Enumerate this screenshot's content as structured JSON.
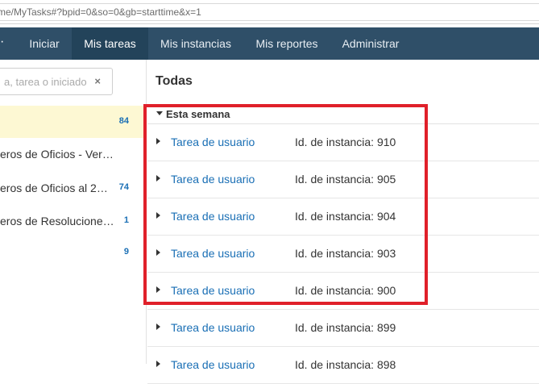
{
  "address_bar": {
    "url": "me/MyTasks#?bpid=0&so=0&gb=starttime&x=1"
  },
  "nav": {
    "items": [
      {
        "label": "Iniciar",
        "active": false
      },
      {
        "label": "Mis tareas",
        "active": true
      },
      {
        "label": "Mis instancias",
        "active": false
      },
      {
        "label": "Mis reportes",
        "active": false
      },
      {
        "label": "Administrar",
        "active": false
      }
    ],
    "colors": {
      "bar": "#2f4f68",
      "active": "#23435a"
    }
  },
  "sidebar": {
    "search": {
      "placeholder": "a, tarea o iniciado",
      "clear_icon": "×"
    },
    "items": [
      {
        "label": "",
        "count": "84",
        "highlighted": true
      },
      {
        "label": "eros de Oficios - Versió…",
        "count": ""
      },
      {
        "label": "eros de Oficios al 2…",
        "count": "74"
      },
      {
        "label": "eros de Resoluciones…",
        "count": "1"
      },
      {
        "label": "",
        "count": "9"
      }
    ]
  },
  "main": {
    "title": "Todas",
    "group": {
      "title": "Esta semana"
    },
    "tasks": [
      {
        "name": "Tarea de usuario",
        "instance": "Id. de instancia: 910"
      },
      {
        "name": "Tarea de usuario",
        "instance": "Id. de instancia: 905"
      },
      {
        "name": "Tarea de usuario",
        "instance": "Id. de instancia: 904"
      },
      {
        "name": "Tarea de usuario",
        "instance": "Id. de instancia: 903"
      },
      {
        "name": "Tarea de usuario",
        "instance": "Id. de instancia: 900"
      },
      {
        "name": "Tarea de usuario",
        "instance": "Id. de instancia: 899"
      },
      {
        "name": "Tarea de usuario",
        "instance": "Id. de instancia: 898"
      }
    ]
  },
  "annotation": {
    "color": "#e0202a"
  }
}
